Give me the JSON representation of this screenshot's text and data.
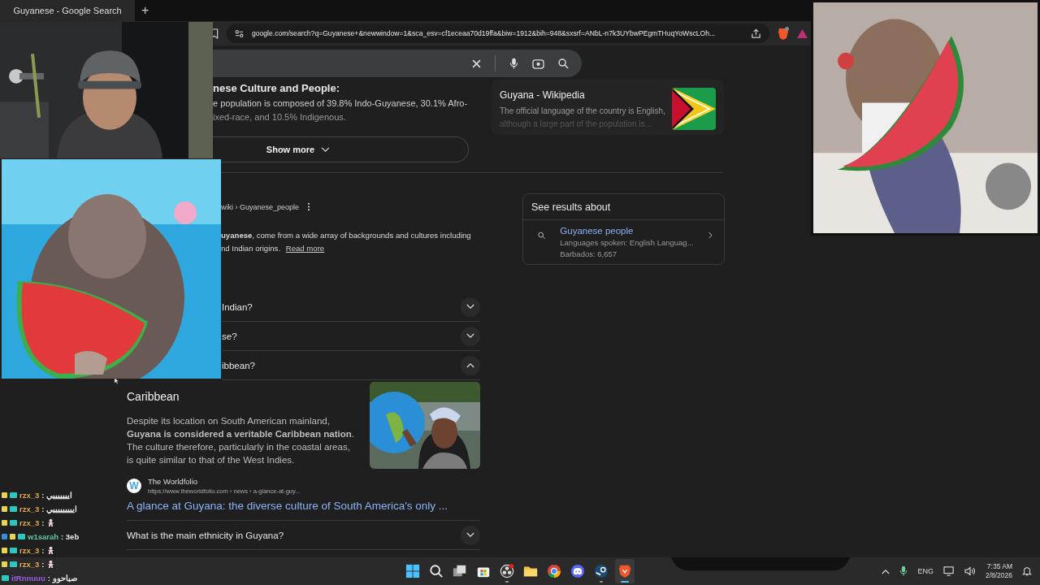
{
  "browser": {
    "tabs": [
      {
        "title": "Guyanese - Google Search",
        "selected": true
      }
    ],
    "new_tab": "+",
    "url": "google.com/search?q=Guyanese+&newwindow=1&sca_esv=cf1eceaa70d19ffa&biw=1912&bih=948&sxsrf=ANbL-n7k3UYbwPEgmTHuqYoWscLOh..."
  },
  "overview": {
    "heading": "nese Culture and People:",
    "lines": [
      "e population is composed of 39.8% Indo-Guyanese, 30.1% Afro-",
      "ixed-race, and 10.5% Indigenous."
    ],
    "show_more": "Show more"
  },
  "wiki_card": {
    "title": "Guyana - Wikipedia",
    "lines": [
      "The official language of the country is English,",
      "although a large part of the population is..."
    ]
  },
  "result": {
    "breadcrumb": "wiki › Guyanese_people",
    "lines": [
      "**uyanese**, come from a wide array of backgrounds and cultures including",
      "nd Indian origins."
    ],
    "read_more": "Read more"
  },
  "questions": [
    {
      "text": "Indian?",
      "expanded": false,
      "partial": true
    },
    {
      "text": "se?",
      "expanded": false,
      "partial": true
    },
    {
      "text": "ibbean?",
      "expanded": true,
      "partial": true,
      "answer": {
        "title": "Caribbean",
        "text": "Despite its location on South American mainland, **Guyana is considered a veritable Caribbean nation**. The culture therefore, particularly in the coastal areas, is quite similar to that of the West Indies.",
        "source_logo": "W",
        "source_name": "The Worldfolio",
        "source_url": "https://www.theworldfolio.com › news › a-glance-at-guy...",
        "link": "A glance at Guyana: the diverse culture of South America's only ..."
      }
    },
    {
      "text": "What is the main ethnicity in Guyana?",
      "expanded": false,
      "partial": false
    }
  ],
  "see_results": {
    "title": "See results about",
    "items": [
      {
        "name": "Guyanese people",
        "lines": [
          "Languages spoken: English Languag...",
          "Barbados: 6,657"
        ]
      }
    ]
  },
  "chat": [
    {
      "vip_badge": false,
      "mod_badge": true,
      "user": "rzx_3",
      "color": "#e0a94a",
      "kind": "text",
      "message": ": ايييييييي"
    },
    {
      "vip_badge": false,
      "mod_badge": true,
      "user": "rzx_3",
      "color": "#e0a94a",
      "kind": "text",
      "message": ": ايييييييييي"
    },
    {
      "vip_badge": false,
      "mod_badge": true,
      "user": "rzx_3",
      "color": "#e0a94a",
      "kind": "emote",
      "message": ":"
    },
    {
      "vip_badge": true,
      "mod_badge": true,
      "user": "w1sarah",
      "color": "#5fc9a0",
      "kind": "text",
      "message": ": 3eb"
    },
    {
      "vip_badge": false,
      "mod_badge": true,
      "user": "rzx_3",
      "color": "#e0a94a",
      "kind": "emote",
      "message": ":"
    },
    {
      "vip_badge": false,
      "mod_badge": true,
      "user": "rzx_3",
      "color": "#e0a94a",
      "kind": "emote",
      "message": ":"
    },
    {
      "vip_badge": false,
      "mod_badge": false,
      "user": "itRnnuuu",
      "color": "#9b5de5",
      "kind": "text",
      "message": ": صباحوو"
    }
  ],
  "taskbar": {
    "apps": [
      {
        "kind": "start",
        "running": false
      },
      {
        "kind": "search",
        "running": false
      },
      {
        "kind": "taskview",
        "running": false
      },
      {
        "kind": "store",
        "running": false
      },
      {
        "kind": "obs",
        "running": true
      },
      {
        "kind": "folder",
        "running": false
      },
      {
        "kind": "chrome",
        "running": false
      },
      {
        "kind": "discord",
        "running": false
      },
      {
        "kind": "steam",
        "running": true
      },
      {
        "kind": "brave",
        "running": true,
        "selected": true
      }
    ],
    "language": "ENG",
    "time": "7:35 AM",
    "date": "2/8/2026"
  }
}
